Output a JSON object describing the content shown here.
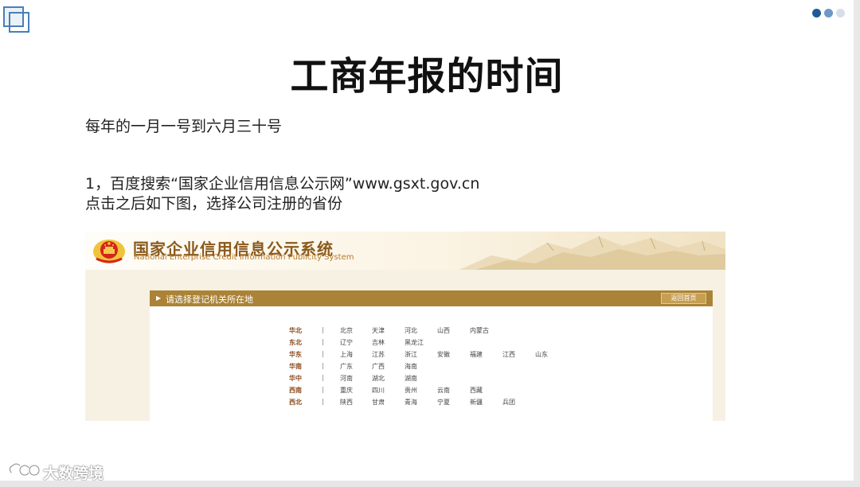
{
  "slide": {
    "title": "工商年报的时间",
    "line1": "每年的一月一号到六月三十号",
    "line2": "1，百度搜索“国家企业信用信息公示网”www.gsxt.gov.cn",
    "line3": "点击之后如下图，选择公司注册的省份",
    "page_dots": 3,
    "active_dot": 1
  },
  "screenshot": {
    "brand_cn": "国家企业信用信息公示系统",
    "brand_en": "National Enterprise Credit Information Publicity System",
    "bar_title": "请选择登记机关所在地",
    "back_button": "返回首页",
    "separator": "|",
    "regions": [
      {
        "name": "华北",
        "provinces": [
          "北京",
          "天津",
          "河北",
          "山西",
          "内蒙古"
        ]
      },
      {
        "name": "东北",
        "provinces": [
          "辽宁",
          "吉林",
          "黑龙江"
        ]
      },
      {
        "name": "华东",
        "provinces": [
          "上海",
          "江苏",
          "浙江",
          "安徽",
          "福建",
          "江西",
          "山东"
        ]
      },
      {
        "name": "华南",
        "provinces": [
          "广东",
          "广西",
          "海南"
        ]
      },
      {
        "name": "华中",
        "provinces": [
          "河南",
          "湖北",
          "湖南"
        ]
      },
      {
        "name": "西南",
        "provinces": [
          "重庆",
          "四川",
          "贵州",
          "云南",
          "西藏"
        ]
      },
      {
        "name": "西北",
        "provinces": [
          "陕西",
          "甘肃",
          "青海",
          "宁夏",
          "新疆",
          "兵团"
        ]
      }
    ]
  },
  "watermark": {
    "text": "大数跨境",
    "icon": "infinity-cloud-logo-icon"
  },
  "colors": {
    "accent_blue": "#1f5a96",
    "bar_gold": "#ab8336",
    "region_brown": "#8a4a1a",
    "brand_brown": "#8a5a1c"
  }
}
